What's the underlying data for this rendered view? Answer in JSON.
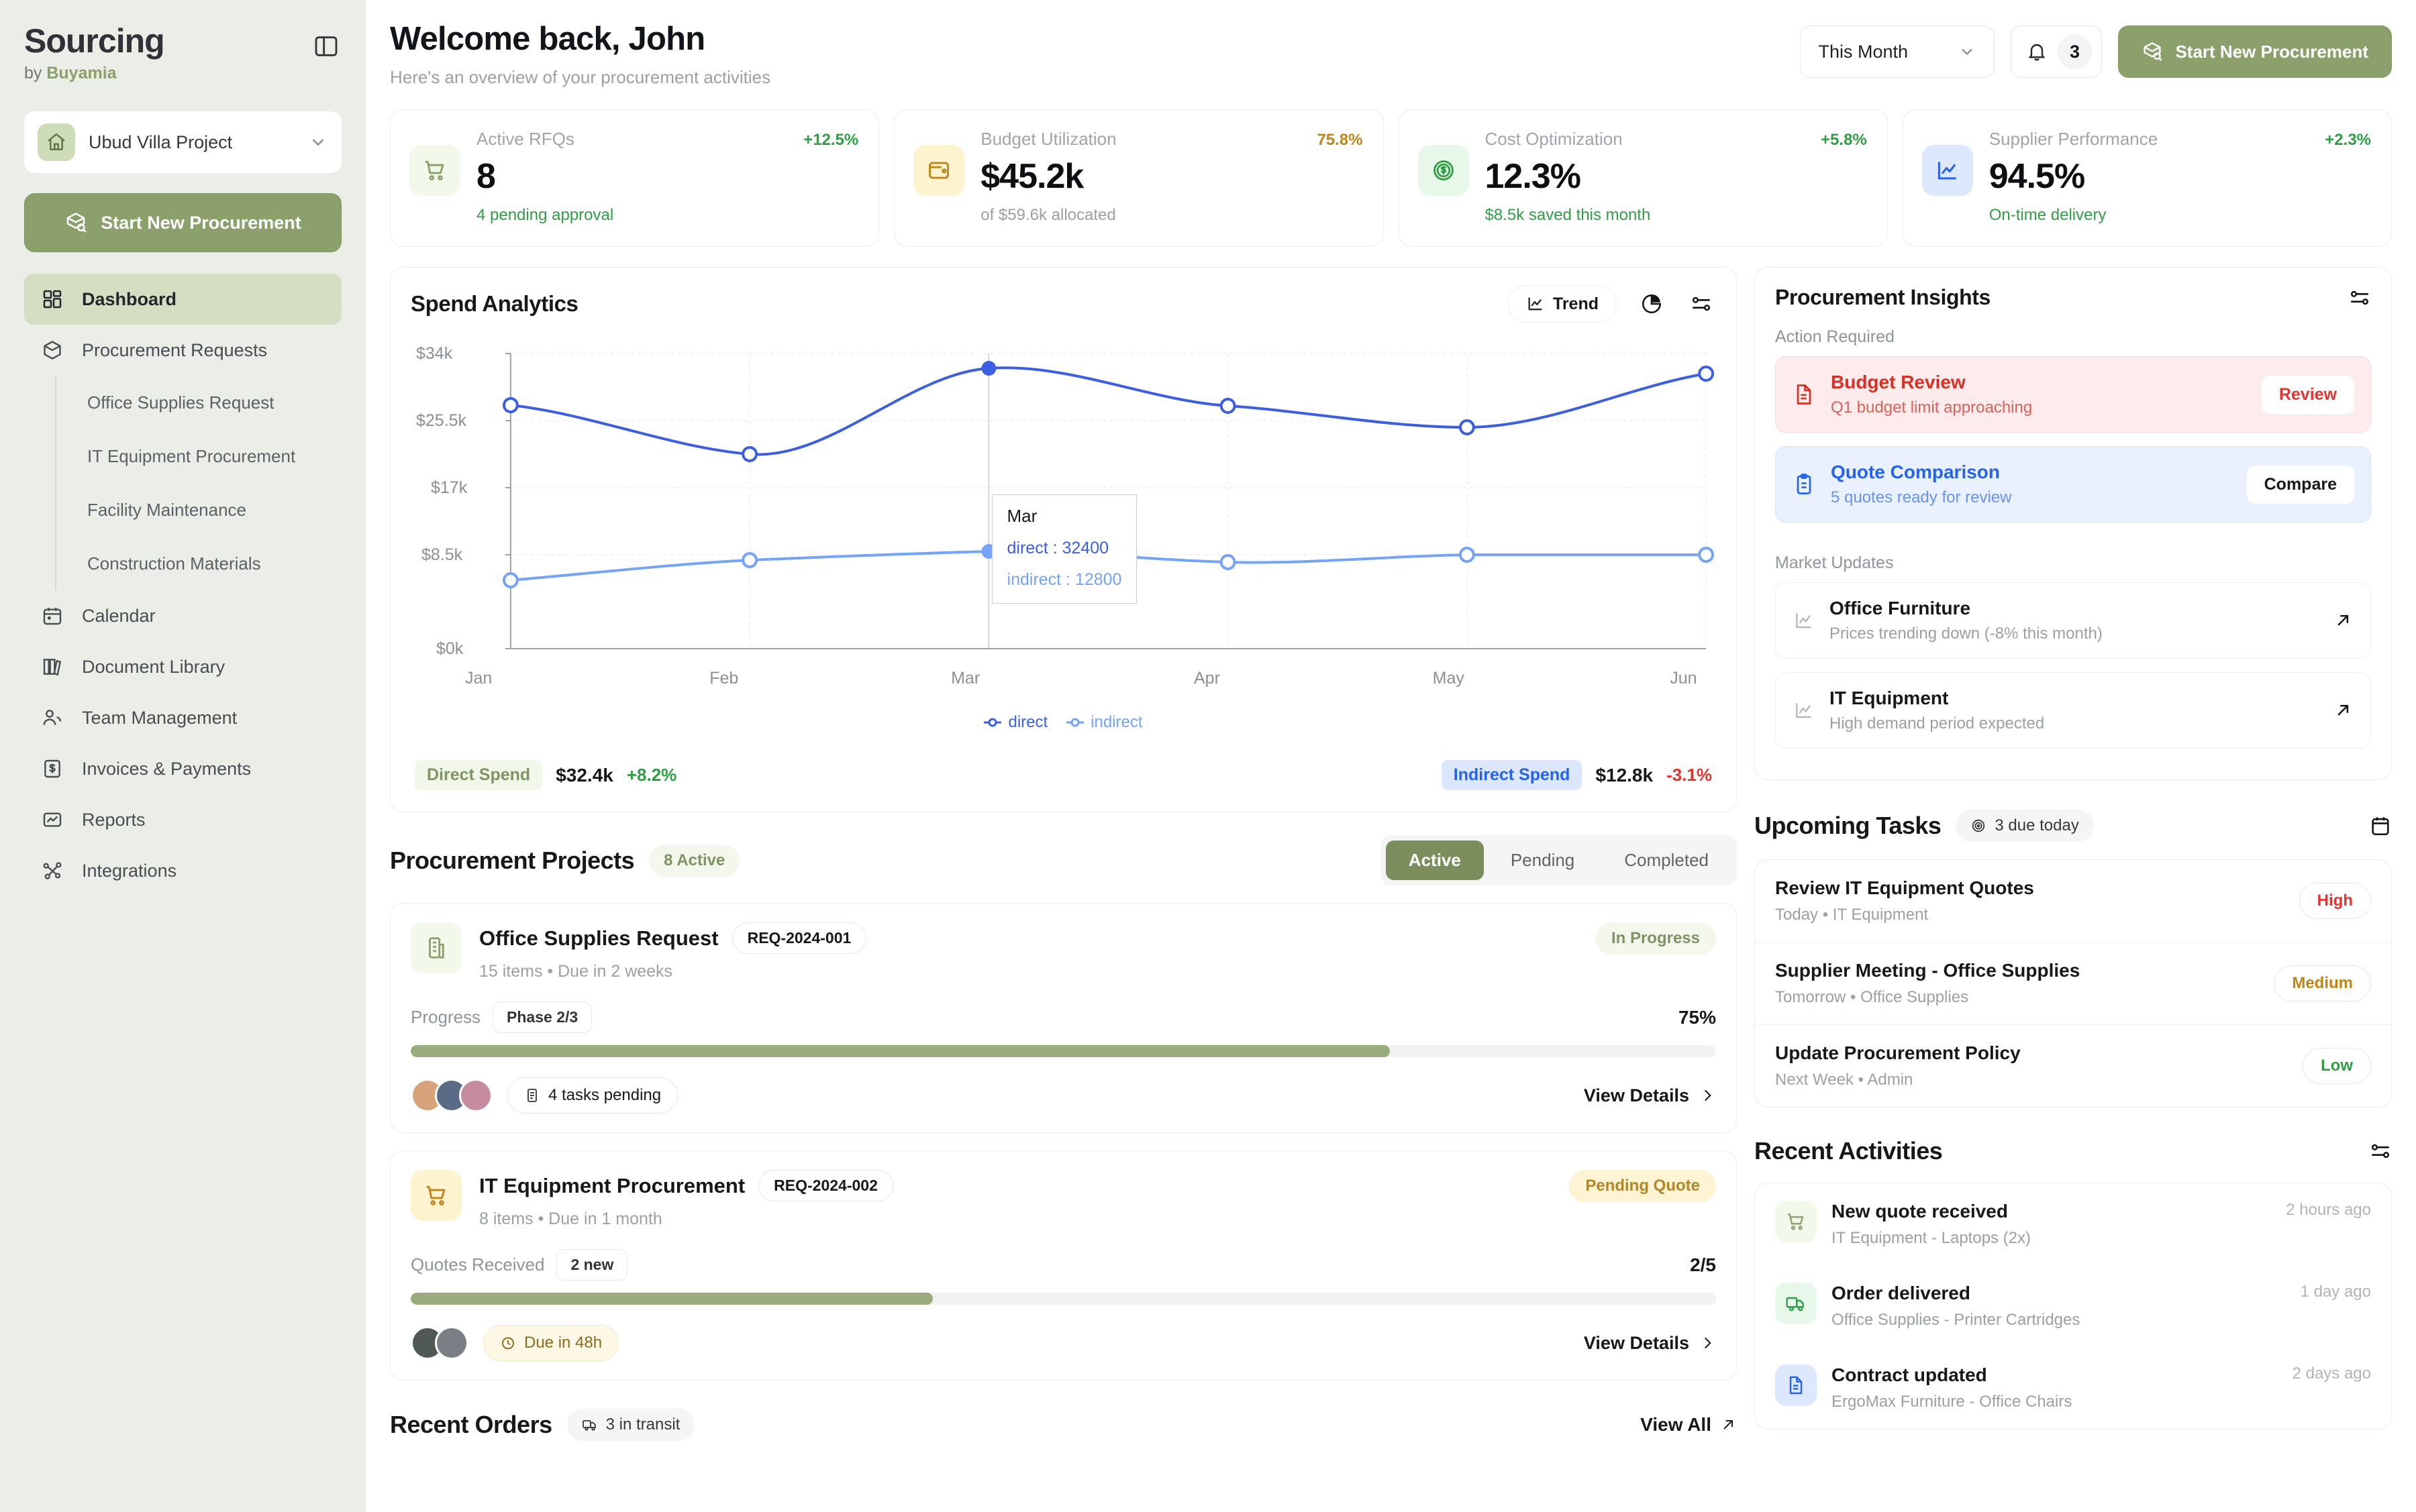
{
  "sidebar": {
    "brand": "Sourcing",
    "brand_by_prefix": "by ",
    "brand_by_name": "Buyamia",
    "project_name": "Ubud Villa Project",
    "cta_label": "Start New Procurement",
    "nav": [
      {
        "label": "Dashboard",
        "icon": "grid-icon",
        "active": true
      },
      {
        "label": "Procurement Requests",
        "icon": "box-icon",
        "active": false
      }
    ],
    "subnav": [
      {
        "label": "Office Supplies Request"
      },
      {
        "label": "IT Equipment Procurement"
      },
      {
        "label": "Facility Maintenance"
      },
      {
        "label": "Construction Materials"
      }
    ],
    "nav_rest": [
      {
        "label": "Calendar",
        "icon": "calendar-icon"
      },
      {
        "label": "Document Library",
        "icon": "library-icon"
      },
      {
        "label": "Team Management",
        "icon": "users-icon"
      },
      {
        "label": "Invoices & Payments",
        "icon": "invoice-icon"
      },
      {
        "label": "Reports",
        "icon": "chart-icon"
      },
      {
        "label": "Integrations",
        "icon": "nodes-icon"
      }
    ]
  },
  "header": {
    "title": "Welcome back, John",
    "subtitle": "Here's an overview of your procurement activities",
    "period_value": "This Month",
    "notification_count": "3",
    "primary_button": "Start New Procurement"
  },
  "kpis": [
    {
      "label": "Active RFQs",
      "delta": "+12.5%",
      "delta_color": "#2f9e44",
      "value": "8",
      "foot": "4 pending approval",
      "foot_color": "#2f9e44",
      "icon": "cart-icon",
      "icon_bg": "#f2f8ea",
      "icon_color": "#8ca06b"
    },
    {
      "label": "Budget Utilization",
      "delta": "75.8%",
      "delta_color": "#c08418",
      "value": "$45.2k",
      "foot": "of  $59.6k  allocated",
      "foot_color": "#9aa0a6",
      "icon": "wallet-icon",
      "icon_bg": "#fdf3cf",
      "icon_color": "#c08418"
    },
    {
      "label": "Cost Optimization",
      "delta": "+5.8%",
      "delta_color": "#2f9e44",
      "value": "12.3%",
      "foot": "$8.5k saved  this month",
      "foot_color": "#2f9e44",
      "icon": "dollar-circle-icon",
      "icon_bg": "#e7f8ea",
      "icon_color": "#2f9e44"
    },
    {
      "label": "Supplier Performance",
      "delta": "+2.3%",
      "delta_color": "#2f9e44",
      "value": "94.5%",
      "foot": "On-time delivery",
      "foot_color": "#2f9e44",
      "icon": "line-chart-icon",
      "icon_bg": "#dde8fd",
      "icon_color": "#2563eb"
    }
  ],
  "spend": {
    "title": "Spend Analytics",
    "trend_label": "Trend",
    "direct_chip": "Direct Spend",
    "direct_amount": "$32.4k",
    "direct_delta": "+8.2%",
    "indirect_chip": "Indirect Spend",
    "indirect_amount": "$12.8k",
    "indirect_delta": "-3.1%",
    "tooltip": {
      "title": "Mar",
      "line1": "direct : 32400",
      "line2": "indirect : 12800"
    }
  },
  "chart_data": {
    "type": "line",
    "title": "Spend Analytics",
    "x": [
      "Jan",
      "Feb",
      "Mar",
      "Apr",
      "May",
      "Jun"
    ],
    "ylabel": "",
    "xlabel": "",
    "ylim": [
      0,
      34000
    ],
    "ytick_labels": [
      "$0k",
      "$8.5k",
      "$17k",
      "$25.5k",
      "$34k"
    ],
    "ytick_values": [
      0,
      8500,
      17000,
      25500,
      34000
    ],
    "grid": true,
    "legend_position": "bottom",
    "series": [
      {
        "name": "direct",
        "color": "#3b5fe0",
        "values": [
          28000,
          24800,
          32400,
          28700,
          26800,
          32000
        ]
      },
      {
        "name": "indirect",
        "color": "#74a3f7",
        "values": [
          9900,
          11800,
          12800,
          11400,
          12400,
          12400
        ]
      }
    ],
    "highlight_x": "Mar"
  },
  "insights": {
    "title": "Procurement Insights",
    "action_label": "Action Required",
    "actions": [
      {
        "title": "Budget Review",
        "subtitle": "Q1 budget limit approaching",
        "button": "Review",
        "tone": "red",
        "icon": "document-alert-icon"
      },
      {
        "title": "Quote Comparison",
        "subtitle": "5 quotes ready for review",
        "button": "Compare",
        "tone": "blue",
        "icon": "clipboard-icon"
      }
    ],
    "market_label": "Market Updates",
    "market": [
      {
        "title": "Office Furniture",
        "subtitle": "Prices trending down (-8% this month)",
        "icon": "trend-icon"
      },
      {
        "title": "IT Equipment",
        "subtitle": "High demand period expected",
        "icon": "trend-icon"
      }
    ]
  },
  "projects": {
    "title": "Procurement Projects",
    "count_badge": "8 Active",
    "tabs": [
      {
        "label": "Active",
        "active": true
      },
      {
        "label": "Pending",
        "active": false
      },
      {
        "label": "Completed",
        "active": false
      }
    ],
    "items": [
      {
        "name": "Office Supplies Request",
        "req": "REQ-2024-001",
        "meta": "15 items • Due in 2 weeks",
        "status": "In Progress",
        "status_tone": "green",
        "progress_label": "Progress",
        "phase_badge": "Phase 2/3",
        "progress_value": "75%",
        "progress_pct": 75,
        "tag": "4 tasks pending",
        "tag_tone": "plain",
        "tag_icon": "tasks-icon",
        "view": "View Details",
        "icon": "building-icon",
        "icon_bg": "#f2f8ea",
        "icon_color": "#8ca06b",
        "avatars": [
          "#d8a27a",
          "#5a6b86",
          "#c78ba0"
        ]
      },
      {
        "name": "IT Equipment Procurement",
        "req": "REQ-2024-002",
        "meta": "8 items • Due in 1 month",
        "status": "Pending Quote",
        "status_tone": "yellow",
        "progress_label": "Quotes Received",
        "phase_badge": "2 new",
        "progress_value": "2/5",
        "progress_pct": 40,
        "tag": "Due in 48h",
        "tag_tone": "yellow",
        "tag_icon": "clock-icon",
        "view": "View Details",
        "icon": "cart-icon",
        "icon_bg": "#fdf3cf",
        "icon_color": "#c08418",
        "avatars": [
          "#4f5a55",
          "#7a7f86"
        ]
      }
    ]
  },
  "orders": {
    "title": "Recent Orders",
    "badge": "3 in transit",
    "view_all": "View All"
  },
  "tasks": {
    "title": "Upcoming Tasks",
    "badge": "3 due today",
    "items": [
      {
        "title": "Review IT Equipment Quotes",
        "meta": "Today  •  IT Equipment",
        "priority": "High",
        "tone": "high"
      },
      {
        "title": "Supplier Meeting - Office Supplies",
        "meta": "Tomorrow  •  Office Supplies",
        "priority": "Medium",
        "tone": "med"
      },
      {
        "title": "Update Procurement Policy",
        "meta": "Next Week  •  Admin",
        "priority": "Low",
        "tone": "low"
      }
    ]
  },
  "activities": {
    "title": "Recent Activities",
    "items": [
      {
        "title": "New quote received",
        "subtitle": "IT Equipment - Laptops (2x)",
        "time": "2 hours ago",
        "icon": "cart-icon",
        "icon_bg": "#f2f8ea",
        "icon_color": "#8ca06b"
      },
      {
        "title": "Order delivered",
        "subtitle": "Office Supplies - Printer Cartridges",
        "time": "1 day ago",
        "icon": "truck-icon",
        "icon_bg": "#e7f8ea",
        "icon_color": "#2f9e44"
      },
      {
        "title": "Contract updated",
        "subtitle": "ErgoMax Furniture - Office Chairs",
        "time": "2 days ago",
        "icon": "document-icon",
        "icon_bg": "#dde8fd",
        "icon_color": "#2563eb"
      }
    ]
  }
}
